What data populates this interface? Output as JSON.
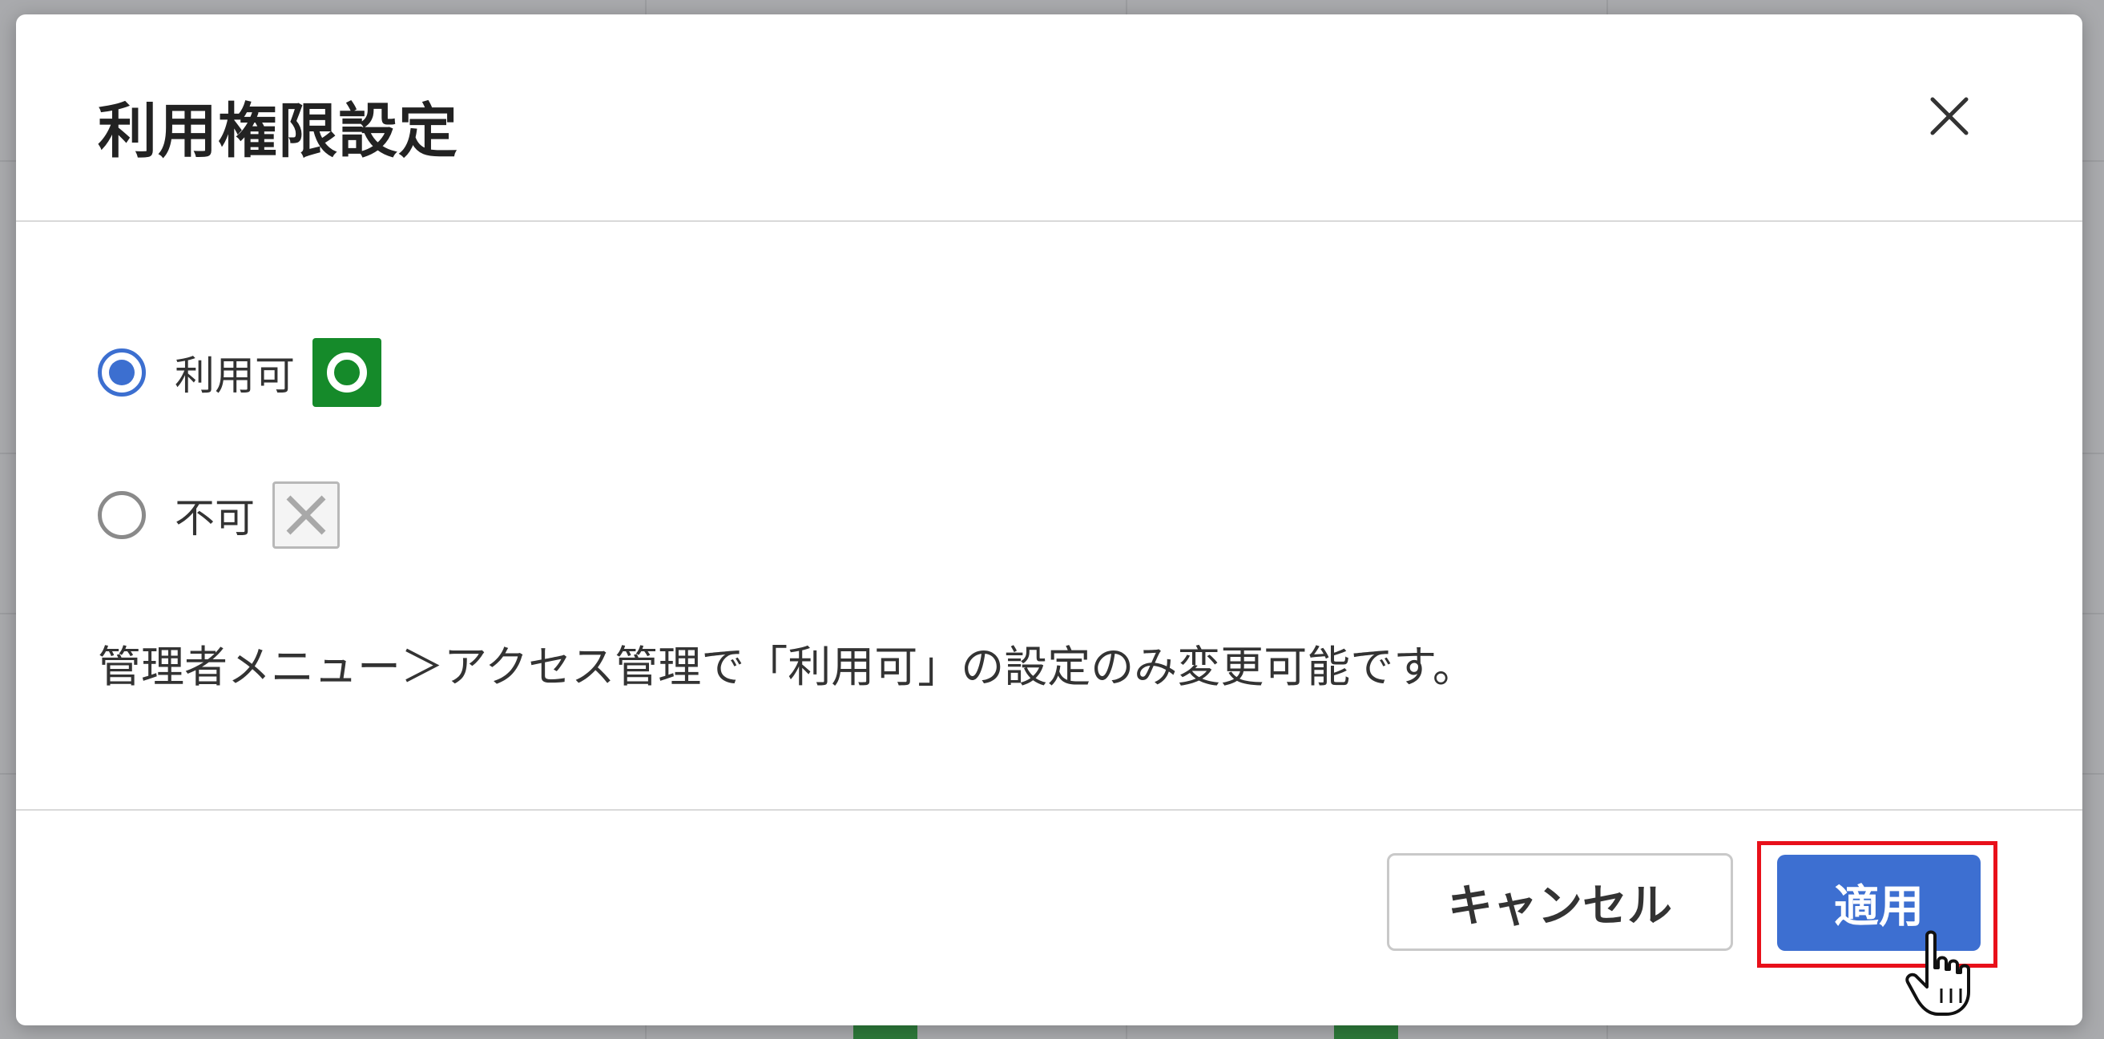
{
  "dialog": {
    "title": "利用権限設定",
    "options": [
      {
        "label": "利用可",
        "selected": true,
        "mark_icon": "green-circle-icon",
        "mark_color": "#158a2a"
      },
      {
        "label": "不可",
        "selected": false,
        "mark_icon": "x-mark-icon"
      }
    ],
    "note": "管理者メニュー＞アクセス管理で「利用可」の設定のみ変更可能です。",
    "buttons": {
      "cancel": "キャンセル",
      "apply": "適用"
    },
    "colors": {
      "accent": "#3d6fd1",
      "highlight": "#e8101a"
    }
  }
}
